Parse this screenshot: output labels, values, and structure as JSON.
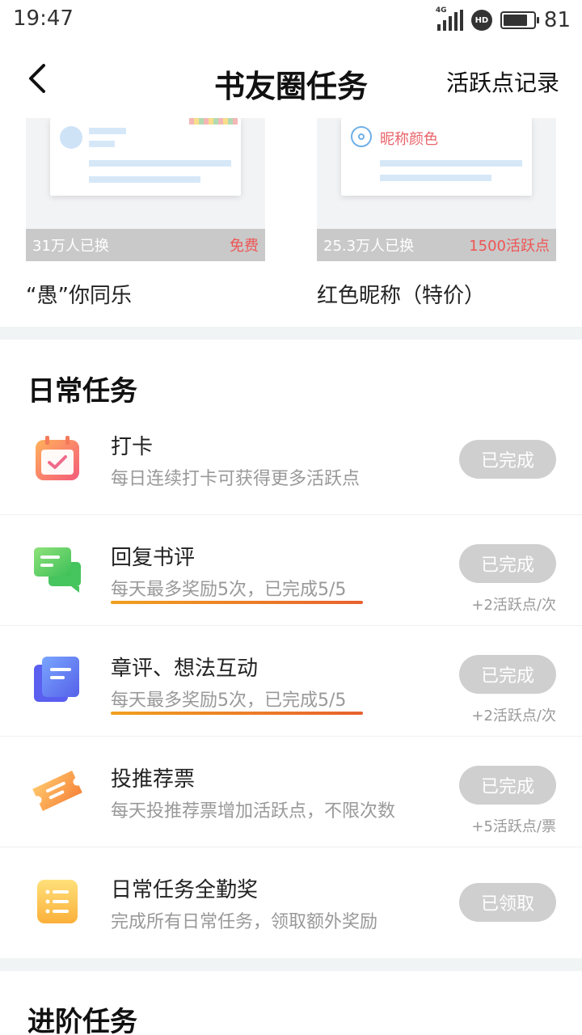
{
  "status_bar": {
    "time": "19:47",
    "network": "4G",
    "hd": "HD",
    "battery_level": 81,
    "battery_text": "81"
  },
  "header": {
    "title": "书友圈任务",
    "right_link": "活跃点记录"
  },
  "cards": [
    {
      "name": "“愚”你同乐",
      "count_text": "31万人已换",
      "price_text": "免费"
    },
    {
      "name": "红色昵称（特价）",
      "count_text": "25.3万人已换",
      "price_text": "1500活跃点",
      "preview_label": "昵称颜色"
    }
  ],
  "daily": {
    "title": "日常任务",
    "tasks": [
      {
        "name": "打卡",
        "desc": "每日连续打卡可获得更多活跃点",
        "button": "已完成",
        "reward": ""
      },
      {
        "name": "回复书评",
        "desc": "每天最多奖励5次，已完成5/5",
        "button": "已完成",
        "reward": "+2活跃点/次",
        "progress": 1.0
      },
      {
        "name": "章评、想法互动",
        "desc": "每天最多奖励5次，已完成5/5",
        "button": "已完成",
        "reward": "+2活跃点/次",
        "progress": 1.0
      },
      {
        "name": "投推荐票",
        "desc": "每天投推荐票增加活跃点，不限次数",
        "button": "已完成",
        "reward": "+5活跃点/票"
      },
      {
        "name": "日常任务全勤奖",
        "desc": "完成所有日常任务，领取额外奖励",
        "button": "已领取",
        "reward": ""
      }
    ]
  },
  "advanced": {
    "title": "进阶任务"
  },
  "icons": {
    "back": "chevron-left-icon",
    "checkin": "calendar-check-icon",
    "reply": "chat-bubbles-icon",
    "interact": "document-stack-icon",
    "vote": "ticket-icon",
    "bonus": "list-icon"
  }
}
